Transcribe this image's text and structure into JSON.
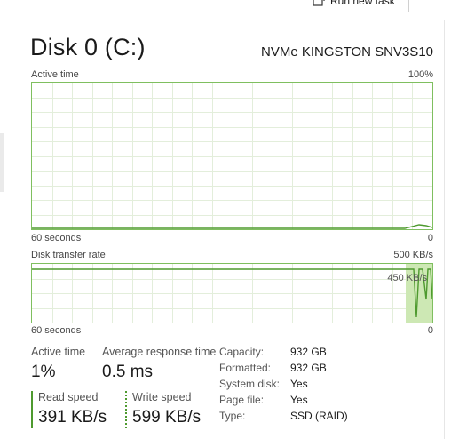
{
  "toolbar": {
    "run_task_label": "Run new task",
    "run_icon": "run-task-icon"
  },
  "header": {
    "title": "Disk 0 (C:)",
    "model": "NVMe KINGSTON SNV3S10"
  },
  "active_time_chart": {
    "label": "Active time",
    "max_label": "100%",
    "time_label": "60 seconds",
    "min_label": "0",
    "line_color": "#4e9a2f"
  },
  "transfer_chart": {
    "label": "Disk transfer rate",
    "max_label": "500 KB/s",
    "mid_label": "450 KB/s",
    "time_label": "60 seconds",
    "min_label": "0",
    "line_color": "#4e9a2f",
    "fill_color": "#cde8b4"
  },
  "stats": {
    "active_time_label": "Active time",
    "active_time_value": "1%",
    "avg_response_label": "Average response time",
    "avg_response_value": "0.5 ms",
    "read_label": "Read speed",
    "read_value": "391 KB/s",
    "write_label": "Write speed",
    "write_value": "599 KB/s"
  },
  "properties": {
    "capacity_label": "Capacity:",
    "capacity_value": "932 GB",
    "formatted_label": "Formatted:",
    "formatted_value": "932 GB",
    "system_disk_label": "System disk:",
    "system_disk_value": "Yes",
    "page_file_label": "Page file:",
    "page_file_value": "Yes",
    "type_label": "Type:",
    "type_value": "SSD (RAID)"
  }
}
